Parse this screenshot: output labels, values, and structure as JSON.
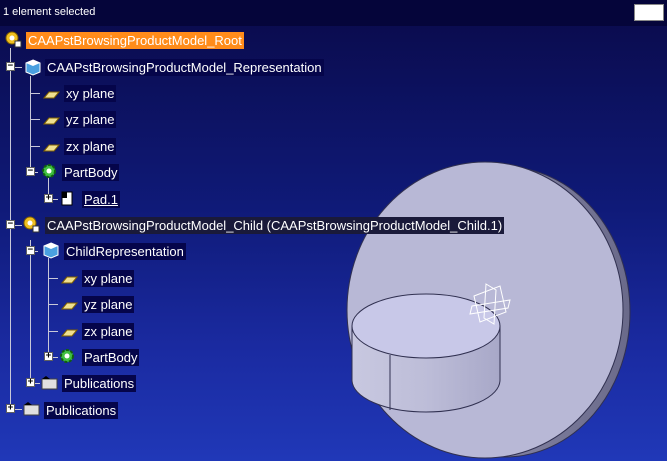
{
  "status": {
    "message": "1 element selected"
  },
  "tree": {
    "root": {
      "label": "CAAPstBrowsingProductModel_Root"
    },
    "representation": {
      "label": "CAAPstBrowsingProductModel_Representation"
    },
    "planes1": [
      "xy plane",
      "yz plane",
      "zx plane"
    ],
    "partbody1": {
      "label": "PartBody"
    },
    "pad": {
      "label": "Pad.1"
    },
    "child": {
      "label": "CAAPstBrowsingProductModel_Child (CAAPstBrowsingProductModel_Child.1)"
    },
    "child_rep": {
      "label": "ChildRepresentation"
    },
    "planes2": [
      "xy plane",
      "yz plane",
      "zx plane"
    ],
    "partbody2": {
      "label": "PartBody"
    },
    "publications1": {
      "label": "Publications"
    },
    "publications2": {
      "label": "Publications"
    }
  },
  "icons": {
    "product": "gear-product-icon",
    "part": "part-cube-icon",
    "plane": "plane-icon",
    "body": "gear-body-icon",
    "pad": "pad-feature-icon",
    "publications": "folder-icon"
  },
  "colors": {
    "selection": "#ff8c1a",
    "background_top": "#0a0a4a",
    "background_bottom": "#2038b8",
    "solid": "#b8b8d8"
  }
}
